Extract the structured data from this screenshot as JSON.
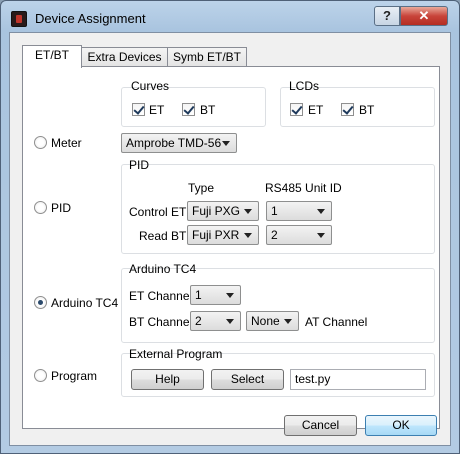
{
  "window": {
    "title": "Device Assignment",
    "help_symbol": "?",
    "close_symbol": "✕"
  },
  "tabs": [
    {
      "label": "ET/BT",
      "active": true
    },
    {
      "label": "Extra Devices",
      "active": false
    },
    {
      "label": "Symb ET/BT",
      "active": false
    }
  ],
  "curves": {
    "title": "Curves",
    "et_label": "ET",
    "bt_label": "BT",
    "et_checked": true,
    "bt_checked": true
  },
  "lcds": {
    "title": "LCDs",
    "et_label": "ET",
    "bt_label": "BT",
    "et_checked": true,
    "bt_checked": true
  },
  "meter": {
    "label": "Meter",
    "selected": false,
    "device": "Amprobe TMD-56"
  },
  "pid": {
    "label": "PID",
    "selected": false,
    "group_title": "PID",
    "type_header": "Type",
    "unit_header": "RS485 Unit ID",
    "control_et_label": "Control ET",
    "control_et_type": "Fuji PXG",
    "control_et_unit": "1",
    "read_bt_label": "Read BT",
    "read_bt_type": "Fuji PXR",
    "read_bt_unit": "2"
  },
  "arduino": {
    "label": "Arduino TC4",
    "selected": true,
    "group_title": "Arduino TC4",
    "et_channel_label": "ET Channel",
    "et_channel": "1",
    "bt_channel_label": "BT Channel",
    "bt_channel": "2",
    "at_channel": "None",
    "at_channel_label": "AT Channel"
  },
  "program": {
    "label": "Program",
    "selected": false,
    "group_title": "External Program",
    "help_label": "Help",
    "select_label": "Select",
    "path": "test.py"
  },
  "footer": {
    "cancel_label": "Cancel",
    "ok_label": "OK"
  }
}
